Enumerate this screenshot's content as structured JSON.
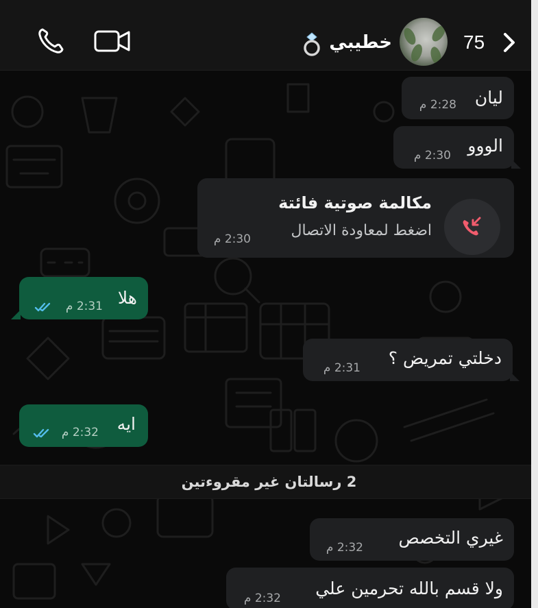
{
  "header": {
    "back_count": "75",
    "contact_name": "خطيبي",
    "icons": [
      "phone-icon",
      "video-camera-icon",
      "ring-emoji-icon",
      "chevron-right-icon"
    ]
  },
  "messages": [
    {
      "direction": "incoming",
      "text": "ليان",
      "time": "2:28 م"
    },
    {
      "direction": "incoming",
      "text": "الووو",
      "time": "2:30 م"
    },
    {
      "direction": "incoming",
      "type": "missed-call",
      "title": "مكالمة صوتية فائتة",
      "subtitle": "اضغط لمعاودة الاتصال",
      "time": "2:30 م"
    },
    {
      "direction": "outgoing",
      "text": "هلا",
      "time": "2:31 م",
      "status": "read"
    },
    {
      "direction": "incoming",
      "text": "دخلتي تمريض ؟",
      "time": "2:31 م"
    },
    {
      "direction": "outgoing",
      "text": "ايه",
      "time": "2:32 م",
      "status": "read"
    },
    {
      "direction": "incoming",
      "text": "غيري التخصص",
      "time": "2:32 م"
    },
    {
      "direction": "incoming",
      "text": "ولا قسم بالله تحرمين علي",
      "time": "2:32 م"
    }
  ],
  "unread_divider": "2 رسالتان غير مقروءتين",
  "colors": {
    "background": "#0a0a0a",
    "header": "#151515",
    "incoming_bubble": "#1f2022",
    "outgoing_bubble": "#0f5c3e",
    "read_ticks": "#53bdeb",
    "missed_call": "#f15c6d"
  }
}
